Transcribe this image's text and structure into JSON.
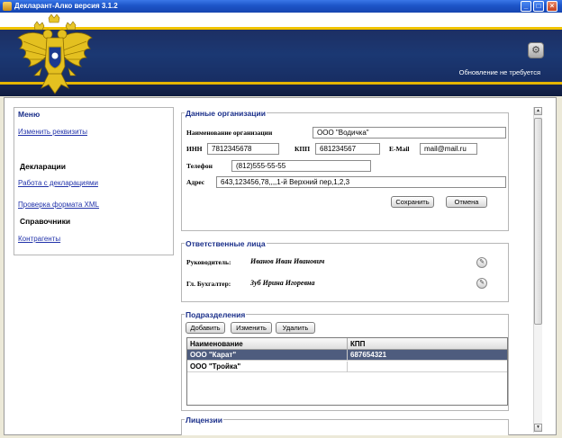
{
  "window": {
    "title": "Декларант-Алко версия 3.1.2",
    "minimize": "_",
    "maximize": "□",
    "close": "×"
  },
  "banner": {
    "update_status": "Обновление не требуется",
    "gear_icon": "gear-icon"
  },
  "sidebar": {
    "menu_title": "Меню",
    "link_change_details": "Изменить реквизиты",
    "section_declarations": "Декларации",
    "link_work_declarations": "Работа с декларациями",
    "link_check_xml": "Проверка формата XML",
    "section_references": "Справочники",
    "link_counterparties": "Контрагенты"
  },
  "org": {
    "title": "Данные организации",
    "name_label": "Наименование организации",
    "name_value": "ООО \"Водичка\"",
    "inn_label": "ИНН",
    "inn_value": "7812345678",
    "kpp_label": "КПП",
    "kpp_value": "681234567",
    "email_label": "E-Mail",
    "email_value": "mail@mail.ru",
    "phone_label": "Телефон",
    "phone_value": "(812)555-55-55",
    "address_label": "Адрес",
    "address_value": "643,123456,78,,,,1-й Верхний пер,1,2,3",
    "save_label": "Сохранить",
    "cancel_label": "Отмена"
  },
  "responsible": {
    "title": "Ответственные лица",
    "director_label": "Руководитель:",
    "director_value": "Иванов Иван Иванович",
    "accountant_label": "Гл. Бухгалтер:",
    "accountant_value": "Зуб Ирина Игоревна"
  },
  "divisions": {
    "title": "Подразделения",
    "add_label": "Добавить",
    "edit_label": "Изменить",
    "delete_label": "Удалить",
    "columns": [
      "Наименование",
      "КПП"
    ],
    "rows": [
      {
        "name": "ООО \"Карат\"",
        "kpp": "687654321",
        "selected": true
      },
      {
        "name": "ООО \"Тройка\"",
        "kpp": "",
        "selected": false
      }
    ]
  },
  "licenses": {
    "title": "Лицензии"
  },
  "colors": {
    "accent": "#1a2f8a",
    "selected_row": "#4e5c7e",
    "banner": "#1b3873",
    "stripe": "#f2c400"
  }
}
